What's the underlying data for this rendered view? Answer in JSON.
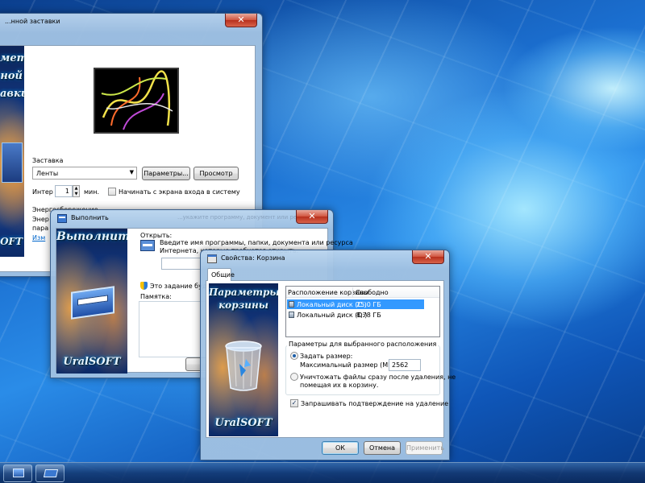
{
  "screensaver_window": {
    "title": "...нной заставки",
    "group_screensaver": "Заставка",
    "screensaver_select": "Ленты",
    "parameters_button": "Параметры...",
    "preview_button": "Просмотр",
    "interval_label": "Интер",
    "interval_value": "1",
    "minutes_label": "мин.",
    "logon_checkbox_label": "Начинать с экрана входа в систему",
    "power_group": "Энергосбережение",
    "power_text_line1": "Энер",
    "power_text_line2": "пара",
    "power_link": "Изм",
    "banner_line1": "метры",
    "banner_line2": "ной",
    "banner_line3": "авки",
    "banner_bottom": "OFT"
  },
  "run_window": {
    "title": "Выполнить",
    "hidden_title_tail": "...укажите программу, документ или ресурс",
    "open_label": "Открыть:",
    "prompt_line1": "Введите имя программы, папки, документа или ресурса",
    "prompt_line2": "Интернета, которые требуется открыть.",
    "task_note": "Это задание будет с",
    "memo_label": "Памятка:",
    "banner_title": "Выполнить",
    "banner_footer": "UralSOFT"
  },
  "recycle_window": {
    "title": "Свойства: Корзина",
    "tab_general": "Общие",
    "columns": [
      "Расположение корзины",
      "Свободно"
    ],
    "rows": [
      {
        "name": "Локальный диск (C:)",
        "free": "25,0 ГБ",
        "selected": true
      },
      {
        "name": "Локальный диск (D:)",
        "free": "8,78 ГБ",
        "selected": false
      }
    ],
    "group_selected": "Параметры для выбранного расположения",
    "radio_custom_size": "Задать размер:",
    "max_size_label": "Максимальный размер (МБ):",
    "max_size_value": "2562",
    "radio_delete_line1": "Уничтожать файлы сразу после удаления, не",
    "radio_delete_line2": "помещая их в корзину.",
    "confirm_checkbox": "Запрашивать подтверждение на удаление",
    "ok_button": "ОК",
    "cancel_button": "Отмена",
    "apply_button": "Применить",
    "banner_line1": "Параметры",
    "banner_line2": "корзины",
    "banner_footer": "UralSOFT"
  },
  "colors": {
    "selection": "#3399ff",
    "link": "#0066cc"
  }
}
